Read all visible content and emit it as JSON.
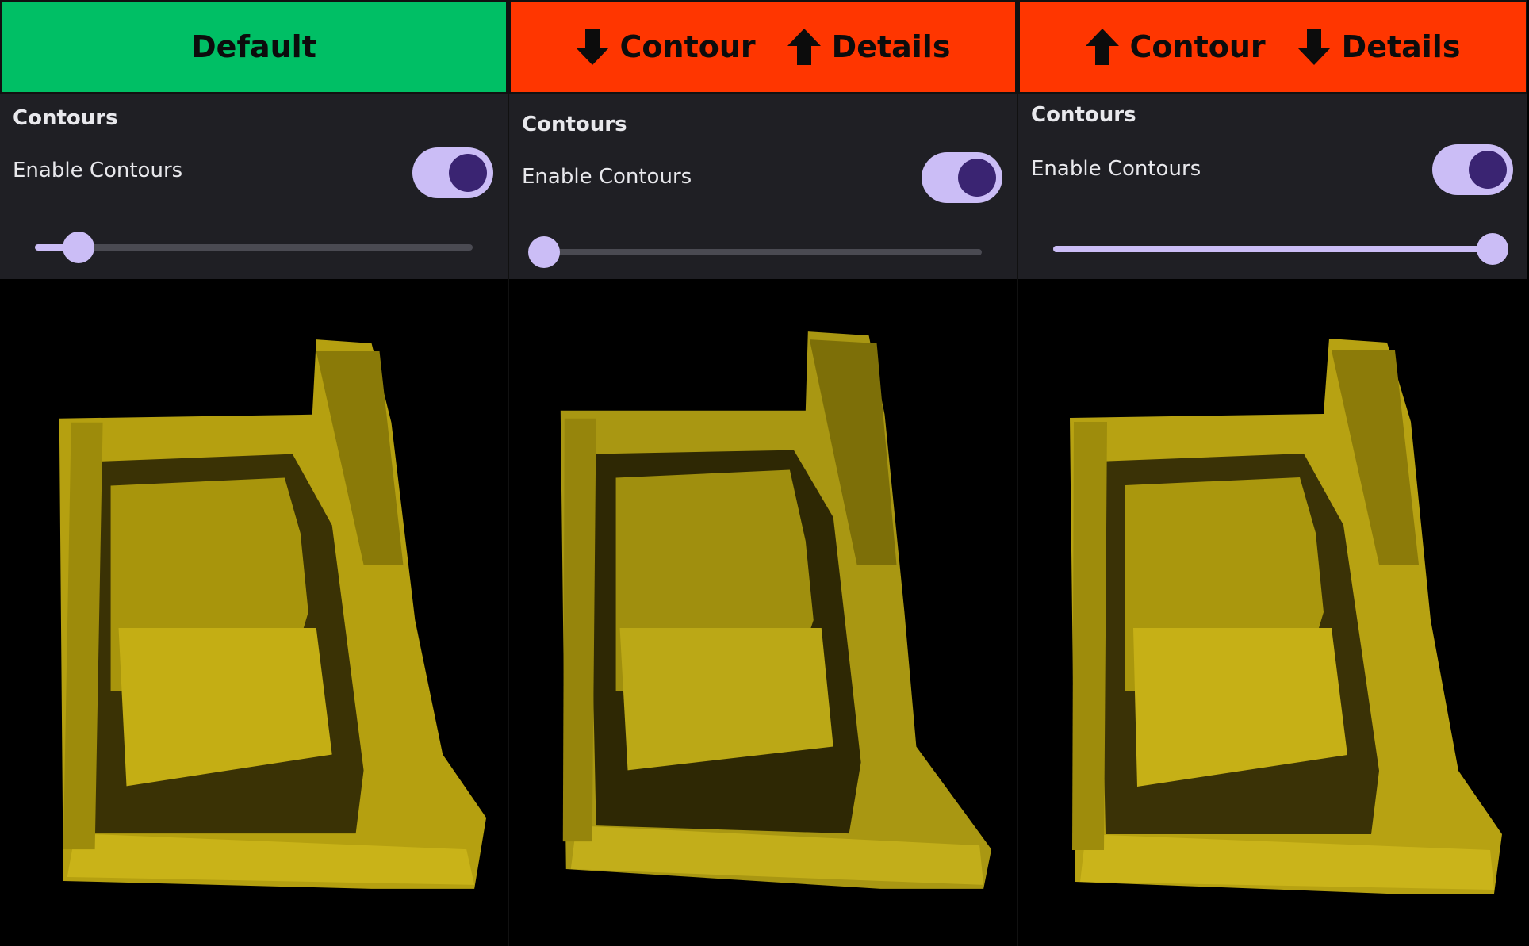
{
  "panels": [
    {
      "banner": {
        "color": "#00bf65",
        "label": "Default"
      },
      "section_title": "Contours",
      "toggle_label": "Enable Contours",
      "toggle_on": true,
      "slider_value": 0.1
    },
    {
      "banner": {
        "color": "#ff3600",
        "left_label": "Contour",
        "right_label": "Details",
        "left_icon": "arrow-down-icon",
        "right_icon": "arrow-up-icon"
      },
      "section_title": "Contours",
      "toggle_label": "Enable Contours",
      "toggle_on": true,
      "slider_value": 0.0
    },
    {
      "banner": {
        "color": "#ff3600",
        "left_label": "Contour",
        "right_label": "Details",
        "left_icon": "arrow-up-icon",
        "right_icon": "arrow-down-icon"
      },
      "section_title": "Contours",
      "toggle_label": "Enable Contours",
      "toggle_on": true,
      "slider_value": 1.0
    }
  ],
  "colors": {
    "accent": "#cbbdf6",
    "knob": "#3a2472",
    "panel_bg": "#1f1f24",
    "voxel": "#b8a20e"
  }
}
